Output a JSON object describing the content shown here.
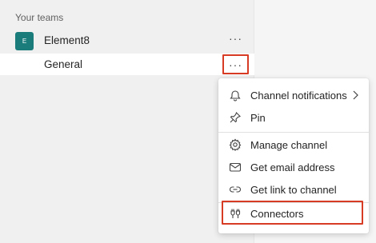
{
  "sidebar": {
    "section_label": "Your teams",
    "team": {
      "avatar_letter": "E",
      "name": "Element8",
      "more": "···"
    },
    "channel": {
      "name": "General",
      "more": "···"
    }
  },
  "context_menu": {
    "items": [
      {
        "label": "Channel notifications",
        "icon": "bell-icon",
        "has_submenu": true
      },
      {
        "label": "Pin",
        "icon": "pin-icon"
      },
      {
        "label": "Manage channel",
        "icon": "gear-icon"
      },
      {
        "label": "Get email address",
        "icon": "mail-icon"
      },
      {
        "label": "Get link to channel",
        "icon": "link-icon"
      },
      {
        "label": "Connectors",
        "icon": "connector-icon"
      }
    ]
  },
  "colors": {
    "highlight": "#d83b24",
    "team_avatar": "#1b7c7c"
  }
}
